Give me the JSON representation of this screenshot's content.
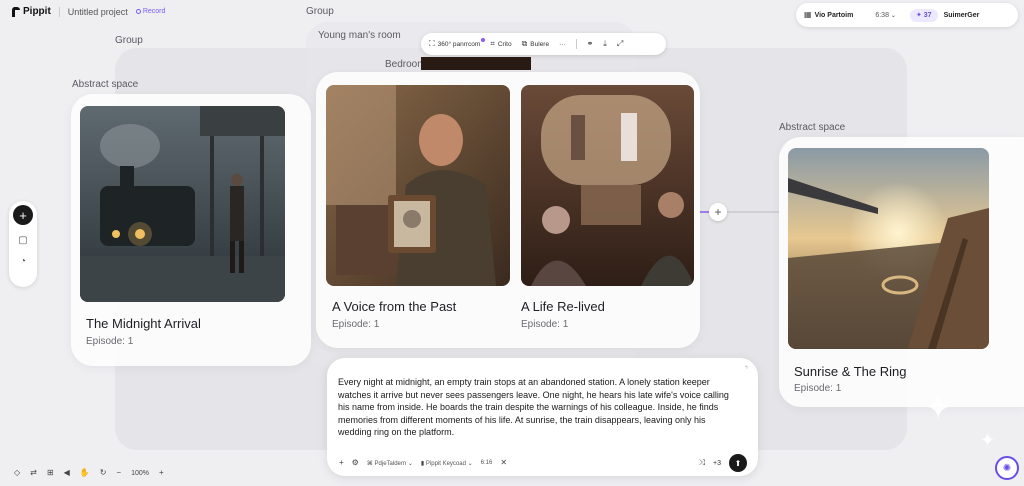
{
  "header": {
    "app_name": "Pippit",
    "project_name": "Untitled project",
    "record_label": "Record",
    "model_label": "Vio Partoim",
    "duration_label": "6:38",
    "credits_label": "37",
    "submit_label": "SuimerGer"
  },
  "groups": {
    "outer_label": "Group",
    "inner_label": "Group"
  },
  "floating_toolbar": {
    "item1": "360° panrrcom",
    "item2": "Crito",
    "item3": "Bulere",
    "more": "···"
  },
  "spaces": {
    "left_label": "Abstract space",
    "right_label": "Abstract space",
    "room_label": "Young man's room",
    "bedroom_label": "Bedroom"
  },
  "cards": [
    {
      "title": "The Midnight Arrival",
      "episode": "Episode: 1"
    },
    {
      "title": "A Voice from the Past",
      "episode": "Episode: 1"
    },
    {
      "title": "A Life Re-lived",
      "episode": "Episode: 1"
    },
    {
      "title": "Sunrise & The Ring",
      "episode": "Episode: 1"
    }
  ],
  "prompt": {
    "text": "Every night at midnight, an empty train stops at an abandoned station. A lonely station keeper watches it arrive but never sees passengers leave. One night, he hears his late wife's voice calling his name from inside. He boards the train despite the warnings of his colleague. Inside, he finds memories from different moments of his life. At sunrise, the train disappears, leaving only his wedding ring on the platform.",
    "chip1": "PdjeTaldern",
    "chip2": "Pippit Keycoad",
    "chip3": "6:16",
    "count": "+3"
  },
  "bottom_toolbar": {
    "zoom": "100%"
  },
  "colors": {
    "accent": "#7a5af8",
    "canvas": "#efeff2"
  }
}
